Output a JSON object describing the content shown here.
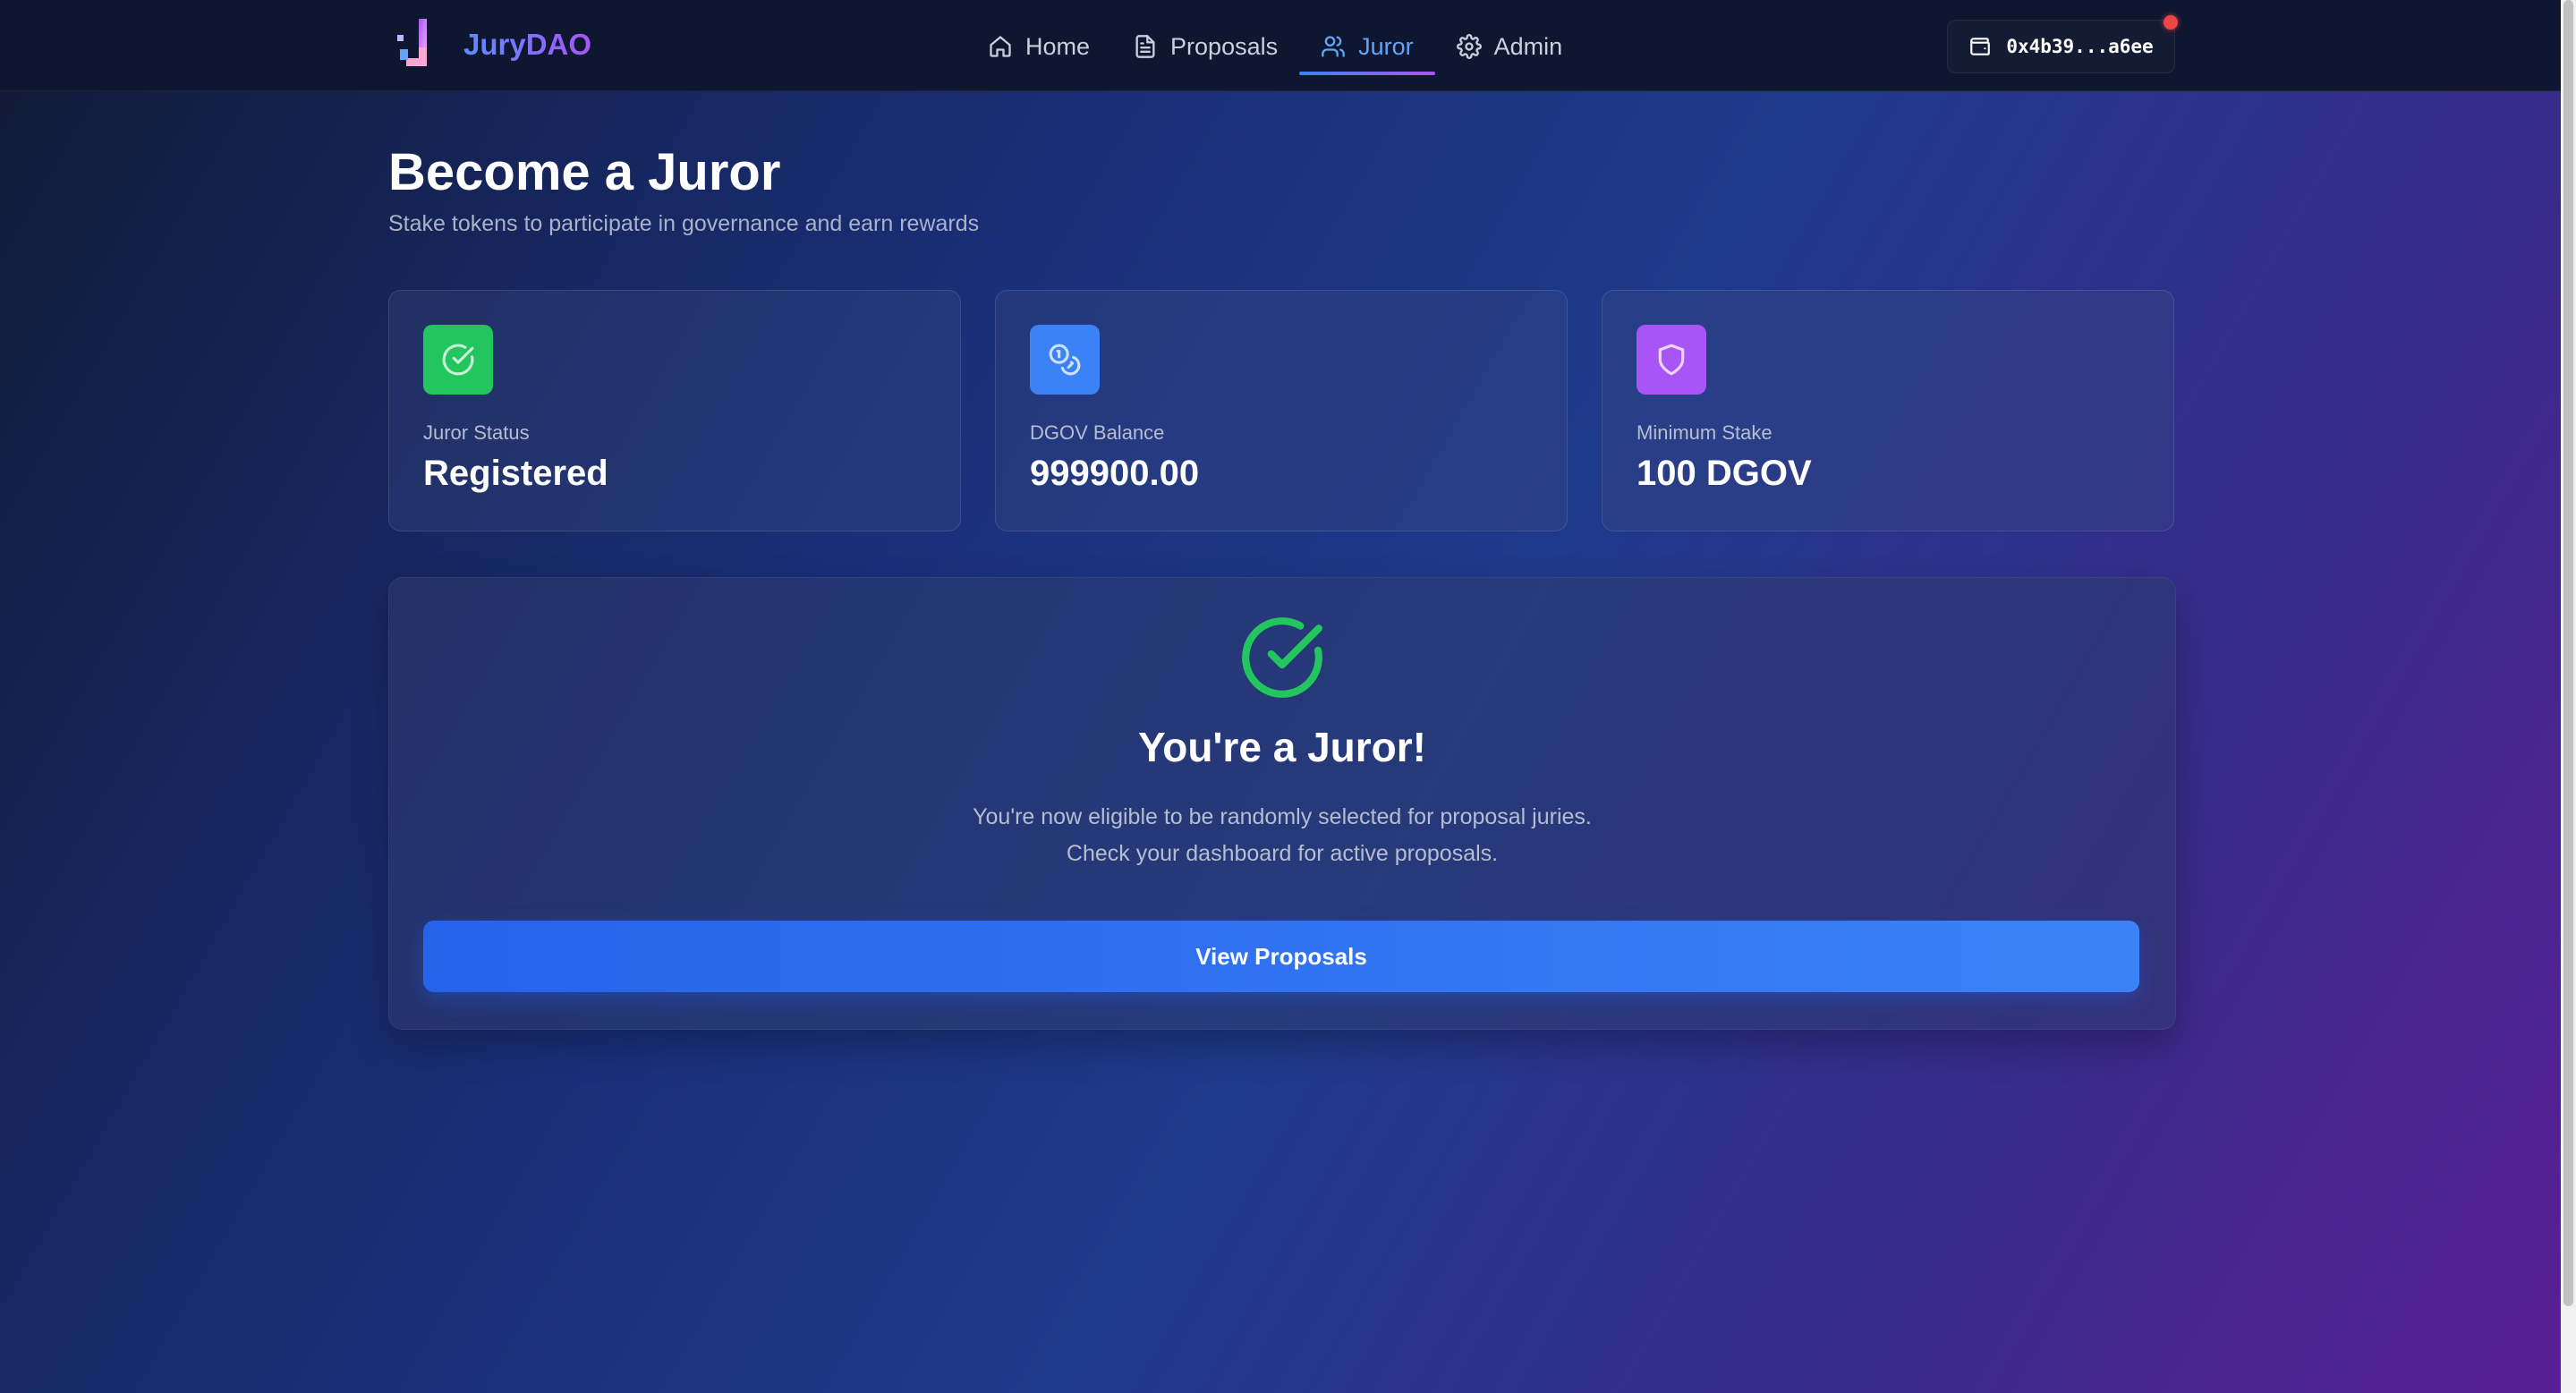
{
  "app": {
    "name": "JuryDAO",
    "logo_icon": "jurydao-logo-mark"
  },
  "nav": {
    "items": [
      {
        "label": "Home",
        "icon": "home-icon",
        "active": false
      },
      {
        "label": "Proposals",
        "icon": "document-icon",
        "active": false
      },
      {
        "label": "Juror",
        "icon": "users-icon",
        "active": true
      },
      {
        "label": "Admin",
        "icon": "gear-icon",
        "active": false
      }
    ]
  },
  "wallet": {
    "address": "0x4b39...a6ee",
    "icon": "wallet-icon",
    "indicator_color": "#ef4444"
  },
  "page": {
    "title": "Become a Juror",
    "subtitle": "Stake tokens to participate in governance and earn rewards"
  },
  "stats": [
    {
      "label": "Juror Status",
      "value": "Registered",
      "icon": "check-circle-icon",
      "color": "#22c55e"
    },
    {
      "label": "DGOV Balance",
      "value": "999900.00",
      "icon": "coins-icon",
      "color": "#3b82f6"
    },
    {
      "label": "Minimum Stake",
      "value": "100 DGOV",
      "icon": "shield-icon",
      "color": "#a855f7"
    }
  ],
  "juror_panel": {
    "icon": "check-circle-icon",
    "title": "You're a Juror!",
    "line1": "You're now eligible to be randomly selected for proposal juries.",
    "line2": "Check your dashboard for active proposals.",
    "button_label": "View Proposals"
  },
  "colors": {
    "accent": "#3b82f6",
    "success": "#22c55e",
    "purple": "#a855f7",
    "nav_bg": "#0f1730"
  }
}
